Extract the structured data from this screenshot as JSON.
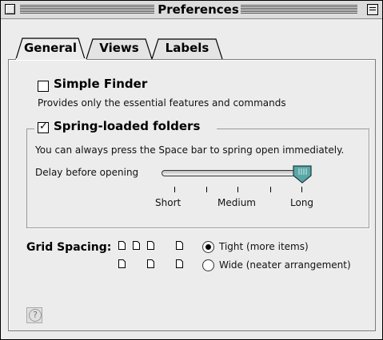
{
  "window": {
    "title": "Preferences"
  },
  "tabs": [
    {
      "label": "General",
      "active": true
    },
    {
      "label": "Views",
      "active": false
    },
    {
      "label": "Labels",
      "active": false
    }
  ],
  "simple_finder": {
    "label": "Simple Finder",
    "checked": false,
    "description": "Provides only the essential features and commands"
  },
  "spring_loaded": {
    "label": "Spring-loaded folders",
    "checked": true,
    "description": "You can always press the Space bar to spring open immediately.",
    "delay_label": "Delay before opening",
    "slider": {
      "value_fraction": 1.0,
      "ticks": [
        "Short",
        "Medium",
        "Long"
      ]
    }
  },
  "grid_spacing": {
    "label": "Grid Spacing:",
    "options": [
      {
        "label": "Tight (more items)",
        "selected": true
      },
      {
        "label": "Wide (neater arrangement)",
        "selected": false
      }
    ]
  },
  "icons": {
    "help": "help-icon",
    "close": "close-box-icon",
    "collapse": "collapse-box-icon",
    "document": "document-icon"
  },
  "colors": {
    "slider_thumb": "#5aa6a6",
    "window_bg": "#ececec"
  }
}
